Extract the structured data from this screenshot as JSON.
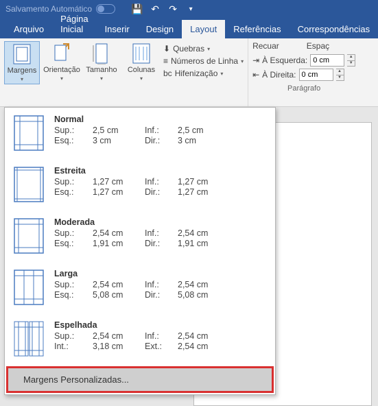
{
  "title_bar": {
    "autosave": "Salvamento Automático"
  },
  "tabs": [
    "Arquivo",
    "Página Inicial",
    "Inserir",
    "Design",
    "Layout",
    "Referências",
    "Correspondências"
  ],
  "active_tab": 4,
  "page_setup": {
    "margins": "Margens",
    "orientation": "Orientação",
    "size": "Tamanho",
    "columns": "Colunas",
    "breaks": "Quebras",
    "line_numbers": "Números de Linha",
    "hyphenation": "Hifenização"
  },
  "paragraph": {
    "header_indent": "Recuar",
    "header_spacing": "Espaç",
    "left": "À Esquerda:",
    "right": "À Direita:",
    "val_left": "0 cm",
    "val_right": "0 cm",
    "label": "Parágrafo"
  },
  "margins_menu": {
    "items": [
      {
        "name": "Normal",
        "rows": [
          [
            "Sup.:",
            "2,5 cm",
            "Inf.:",
            "2,5 cm"
          ],
          [
            "Esq.:",
            "3 cm",
            "Dir.:",
            "3 cm"
          ]
        ],
        "icon": "normal"
      },
      {
        "name": "Estreita",
        "rows": [
          [
            "Sup.:",
            "1,27 cm",
            "Inf.:",
            "1,27 cm"
          ],
          [
            "Esq.:",
            "1,27 cm",
            "Dir.:",
            "1,27 cm"
          ]
        ],
        "icon": "narrow"
      },
      {
        "name": "Moderada",
        "rows": [
          [
            "Sup.:",
            "2,54 cm",
            "Inf.:",
            "2,54 cm"
          ],
          [
            "Esq.:",
            "1,91 cm",
            "Dir.:",
            "1,91 cm"
          ]
        ],
        "icon": "moderate"
      },
      {
        "name": "Larga",
        "rows": [
          [
            "Sup.:",
            "2,54 cm",
            "Inf.:",
            "2,54 cm"
          ],
          [
            "Esq.:",
            "5,08 cm",
            "Dir.:",
            "5,08 cm"
          ]
        ],
        "icon": "wide"
      },
      {
        "name": "Espelhada",
        "rows": [
          [
            "Sup.:",
            "2,54 cm",
            "Inf.:",
            "2,54 cm"
          ],
          [
            "Int.:",
            "3,18 cm",
            "Ext.:",
            "2,54 cm"
          ]
        ],
        "icon": "mirror"
      }
    ],
    "custom": "Margens Personalizadas..."
  }
}
